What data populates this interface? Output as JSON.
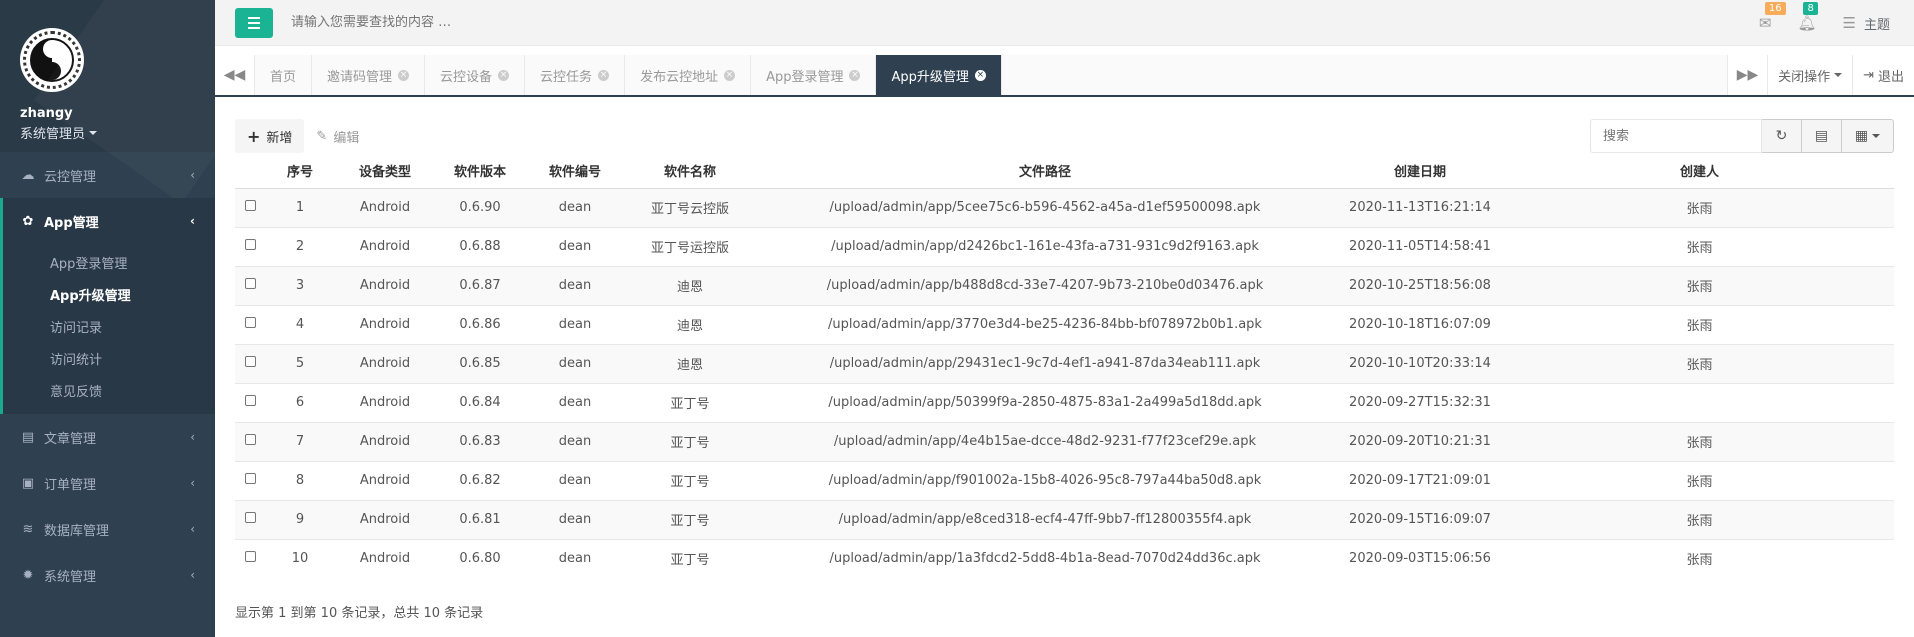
{
  "user": {
    "name": "zhangy",
    "role": "系统管理员"
  },
  "sidebar": {
    "items": [
      {
        "label": "云控管理",
        "icon": "cloud-icon"
      },
      {
        "label": "App管理",
        "icon": "app-icon",
        "active": true,
        "children": [
          {
            "label": "App登录管理"
          },
          {
            "label": "App升级管理",
            "active": true
          },
          {
            "label": "访问记录"
          },
          {
            "label": "访问统计"
          },
          {
            "label": "意见反馈"
          }
        ]
      },
      {
        "label": "文章管理",
        "icon": "book-icon"
      },
      {
        "label": "订单管理",
        "icon": "order-icon"
      },
      {
        "label": "数据库管理",
        "icon": "database-icon"
      },
      {
        "label": "系统管理",
        "icon": "gear-icon"
      }
    ]
  },
  "topbar": {
    "search_placeholder": "请输入您需要查找的内容 …",
    "mail_count": "16",
    "bell_count": "8",
    "theme_label": "主题"
  },
  "tabs": {
    "items": [
      {
        "label": "首页",
        "closable": false
      },
      {
        "label": "邀请码管理",
        "closable": true
      },
      {
        "label": "云控设备",
        "closable": true
      },
      {
        "label": "云控任务",
        "closable": true
      },
      {
        "label": "发布云控地址",
        "closable": true
      },
      {
        "label": "App登录管理",
        "closable": true
      },
      {
        "label": "App升级管理",
        "closable": true,
        "active": true
      }
    ],
    "close_ops_label": "关闭操作",
    "logout_label": "退出"
  },
  "toolbar": {
    "add_label": "新增",
    "edit_label": "编辑",
    "search_placeholder": "搜索"
  },
  "table": {
    "columns": [
      "序号",
      "设备类型",
      "软件版本",
      "软件编号",
      "软件名称",
      "文件路径",
      "创建日期",
      "创建人"
    ],
    "rows": [
      [
        "1",
        "Android",
        "0.6.90",
        "dean",
        "亚丁号云控版",
        "/upload/admin/app/5cee75c6-b596-4562-a45a-d1ef59500098.apk",
        "2020-11-13T16:21:14",
        "张雨"
      ],
      [
        "2",
        "Android",
        "0.6.88",
        "dean",
        "亚丁号运控版",
        "/upload/admin/app/d2426bc1-161e-43fa-a731-931c9d2f9163.apk",
        "2020-11-05T14:58:41",
        "张雨"
      ],
      [
        "3",
        "Android",
        "0.6.87",
        "dean",
        "迪恩",
        "/upload/admin/app/b488d8cd-33e7-4207-9b73-210be0d03476.apk",
        "2020-10-25T18:56:08",
        "张雨"
      ],
      [
        "4",
        "Android",
        "0.6.86",
        "dean",
        "迪恩",
        "/upload/admin/app/3770e3d4-be25-4236-84bb-bf078972b0b1.apk",
        "2020-10-18T16:07:09",
        "张雨"
      ],
      [
        "5",
        "Android",
        "0.6.85",
        "dean",
        "迪恩",
        "/upload/admin/app/29431ec1-9c7d-4ef1-a941-87da34eab111.apk",
        "2020-10-10T20:33:14",
        "张雨"
      ],
      [
        "6",
        "Android",
        "0.6.84",
        "dean",
        "亚丁号",
        "/upload/admin/app/50399f9a-2850-4875-83a1-2a499a5d18dd.apk",
        "2020-09-27T15:32:31",
        ""
      ],
      [
        "7",
        "Android",
        "0.6.83",
        "dean",
        "亚丁号",
        "/upload/admin/app/4e4b15ae-dcce-48d2-9231-f77f23cef29e.apk",
        "2020-09-20T10:21:31",
        "张雨"
      ],
      [
        "8",
        "Android",
        "0.6.82",
        "dean",
        "亚丁号",
        "/upload/admin/app/f901002a-15b8-4026-95c8-797a44ba50d8.apk",
        "2020-09-17T21:09:01",
        "张雨"
      ],
      [
        "9",
        "Android",
        "0.6.81",
        "dean",
        "亚丁号",
        "/upload/admin/app/e8ced318-ecf4-47ff-9bb7-ff12800355f4.apk",
        "2020-09-15T16:09:07",
        "张雨"
      ],
      [
        "10",
        "Android",
        "0.6.80",
        "dean",
        "亚丁号",
        "/upload/admin/app/1a3fdcd2-5dd8-4b1a-8ead-7070d24dd36c.apk",
        "2020-09-03T15:06:56",
        "张雨"
      ]
    ]
  },
  "pagination": {
    "summary": "显示第 1 到第 10 条记录，总共 10 条记录"
  },
  "colors": {
    "accent": "#1ab394",
    "sidebar_bg": "#2f4050",
    "badge_orange": "#f8ac59"
  }
}
